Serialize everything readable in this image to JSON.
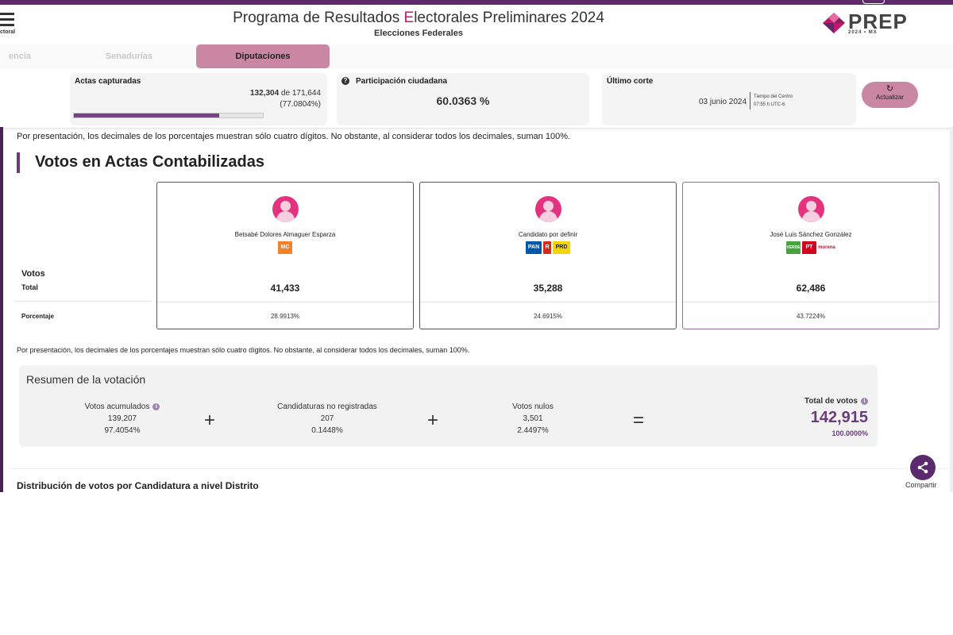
{
  "header": {
    "brand_small": "ctoral",
    "title_before": "Programa de Resultados ",
    "title_accent": "E",
    "title_after": "lectorales Preliminares 2024",
    "subtitle": "Elecciones Federales",
    "logo_text": "PREP",
    "logo_sub": "2024 • MX"
  },
  "tabs": [
    {
      "label": "encia"
    },
    {
      "label": "Senadurías"
    },
    {
      "label": "Diputaciones",
      "active": true
    }
  ],
  "stats": {
    "actas": {
      "label": "Actas capturadas",
      "captured": "132,304",
      "of": "de",
      "total": "171,644",
      "percent": "(77.0804%)",
      "progress": 0.770804
    },
    "participacion": {
      "label": "Participación ciudadana",
      "value": "60.0363 %"
    },
    "corte": {
      "label": "Último corte",
      "date": "03 junio 2024",
      "tz_line1": "Tiempo del Centro",
      "tz_line2": "07:55 h UTC-6"
    },
    "update_button": "Actualizar"
  },
  "note": "Por presentación, los decimales de los porcentajes muestran sólo cuatro dígitos. No obstante, al considerar todos los decimales, suman 100%.",
  "section_title": "Votos en Actas Contabilizadas",
  "row_labels": {
    "votos": "Votos",
    "total": "Total",
    "porcentaje": "Porcentaje"
  },
  "candidates": [
    {
      "name": "Betsabé Dolores Almaguer Esparza",
      "votes": "41,433",
      "percent": "28.9913%",
      "parties": [
        {
          "label": "MC",
          "bg": "#f58025",
          "fg": "#ffffff"
        }
      ]
    },
    {
      "name": "Candidato por definir",
      "votes": "35,288",
      "percent": "24.6915%",
      "parties": [
        {
          "label": "PAN",
          "bg": "#0059a8",
          "fg": "#ffffff"
        },
        {
          "label": "R",
          "bg": "#d52b1e",
          "fg": "#ffffff"
        },
        {
          "label": "PRD",
          "bg": "#f5d400",
          "fg": "#222222"
        }
      ]
    },
    {
      "name": "José Luis Sánchez González",
      "votes": "62,486",
      "percent": "43.7224%",
      "parties": [
        {
          "label": "VERDE",
          "bg": "#47a23f",
          "fg": "#ffffff"
        },
        {
          "label": "PT",
          "bg": "#d3001e",
          "fg": "#ffffff"
        },
        {
          "label": "morena",
          "bg": "#ffffff",
          "fg": "#a31e32"
        }
      ]
    }
  ],
  "resumen": {
    "title": "Resumen de la votación",
    "acumulados": {
      "label": "Votos acumulados",
      "value": "139,207",
      "percent": "97.4054%"
    },
    "no_registradas": {
      "label": "Candidaturas no registradas",
      "value": "207",
      "percent": "0.1448%"
    },
    "nulos": {
      "label": "Votos nulos",
      "value": "3,501",
      "percent": "2.4497%"
    },
    "total": {
      "label": "Total de votos",
      "value": "142,915",
      "percent": "100.0000%"
    },
    "plus": "+",
    "equals": "="
  },
  "distribution_title": "Distribución de votos por Candidatura a nivel Distrito",
  "share_label": "Compartir",
  "colors": {
    "brand_purple": "#5e2a6b",
    "accent_pink": "#c2176d",
    "button_pink": "#c987a3"
  }
}
